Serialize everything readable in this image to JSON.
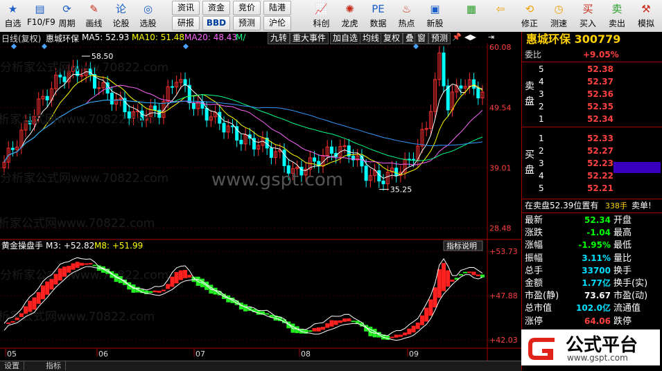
{
  "toolbar": {
    "buttons": [
      {
        "label": "自选",
        "icon": "star-icon"
      },
      {
        "label": "F10/F9",
        "icon": "document-icon"
      },
      {
        "label": "周期",
        "icon": "cycle-icon"
      },
      {
        "label": "画线",
        "icon": "pen-icon"
      },
      {
        "label": "论股",
        "icon": "discuss-icon"
      },
      {
        "label": "选股",
        "icon": "select-icon"
      }
    ],
    "small": [
      "资讯",
      "资金",
      "竞价",
      "陆港",
      "研报",
      "BBD",
      "预测",
      "沪伦"
    ],
    "right_buttons": [
      {
        "label": "科创",
        "icon": "chart-icon"
      },
      {
        "label": "龙虎",
        "icon": "dragon-icon"
      },
      {
        "label": "数据",
        "icon": "pe-icon"
      },
      {
        "label": "热点",
        "icon": "hot-icon"
      },
      {
        "label": "新股",
        "icon": "new-icon"
      }
    ],
    "nav_buttons": [
      {
        "label": "",
        "icon": "grid-icon"
      },
      {
        "label": "",
        "icon": "back-arrow-icon"
      },
      {
        "label": "修正",
        "icon": "refresh-icon"
      },
      {
        "label": "测速",
        "icon": "clock-icon"
      },
      {
        "label": "买入",
        "icon": "buy-icon"
      },
      {
        "label": "卖出",
        "icon": "sell-icon"
      },
      {
        "label": "模拟",
        "icon": "hammer-icon"
      }
    ]
  },
  "header": {
    "period": "日线(复权)",
    "stock_name": "惠城环保",
    "ma5": "MA5: 52.93",
    "ma10": "MA10: 51.48",
    "ma20": "MA20: 48.43",
    "ma_more": "M/",
    "tabs": [
      "九转",
      "重大事件",
      "加自选",
      "均线",
      "复权",
      "叠",
      "窗",
      "预测"
    ]
  },
  "chart": {
    "price_ticks": [
      "60.08",
      "49.54",
      "39.01",
      "28.48"
    ],
    "indicator_ticks": [
      "+53.73",
      "+47.88",
      "+42.03"
    ],
    "high_label": "58.50",
    "low_label": "35.25",
    "month_labels": [
      "05",
      "06",
      "07",
      "08",
      "09"
    ],
    "indicator_name": "黄金操盘手",
    "m3": "M3: +52.82",
    "m8": "M8: +51.99",
    "indicator_button": "指标说明",
    "watermark": "www.gspt.com",
    "watermark_cn": "分析家公式网www.70822.com"
  },
  "panel": {
    "title": "惠城环保 300779",
    "weibi_label": "委比",
    "weibi": "+9.05%",
    "sell_label": "卖盘",
    "buy_label": "买盘",
    "asks": [
      {
        "level": "5",
        "price": "52.38"
      },
      {
        "level": "4",
        "price": "52.37"
      },
      {
        "level": "3",
        "price": "52.36"
      },
      {
        "level": "2",
        "price": "52.35"
      },
      {
        "level": "1",
        "price": "52.34"
      }
    ],
    "bids": [
      {
        "level": "1",
        "price": "52.33"
      },
      {
        "level": "2",
        "price": "52.27"
      },
      {
        "level": "3",
        "price": "52.23"
      },
      {
        "level": "4",
        "price": "52.22"
      },
      {
        "level": "5",
        "price": "52.21"
      }
    ],
    "notice": "在卖盘52.39位置有",
    "notice_qty": "338手",
    "notice_tag": "卖单!",
    "stats": [
      {
        "l": "最新",
        "v": "52.34",
        "r": "开盘"
      },
      {
        "l": "涨跌",
        "v": "-1.04",
        "r": "最高"
      },
      {
        "l": "涨幅",
        "v": "-1.95%",
        "r": "最低"
      },
      {
        "l": "振幅",
        "v": "3.11%",
        "r": "量比"
      },
      {
        "l": "总手",
        "v": "33700",
        "r": "换手"
      },
      {
        "l": "金额",
        "v": "1.77亿",
        "r": "换手(实)"
      },
      {
        "l": "市盈(静)",
        "v": "73.67",
        "r": "市盈(动)"
      },
      {
        "l": "总市值",
        "v": "102.0亿",
        "r": "流通值"
      },
      {
        "l": "涨停",
        "v": "64.06",
        "r": "跌停"
      }
    ]
  },
  "logo": {
    "text": "公式平台",
    "url": "www.gspt.com"
  },
  "statusbar": {
    "tabs": [
      "设置",
      "指标"
    ]
  },
  "chart_data": {
    "type": "line",
    "title": "",
    "y_ticks": [
      60.08,
      49.54,
      39.01,
      28.48
    ],
    "high": 58.5,
    "low": 35.25,
    "indicator_ticks": [
      53.73,
      47.88,
      42.03
    ],
    "colors": {
      "up": "#ff3030",
      "down": "#00ffff",
      "ma5": "#ffffff",
      "ma10": "#ffff00",
      "ma20": "#ff66ff",
      "ma60": "#00ff88",
      "ma120": "#3399ff"
    }
  }
}
